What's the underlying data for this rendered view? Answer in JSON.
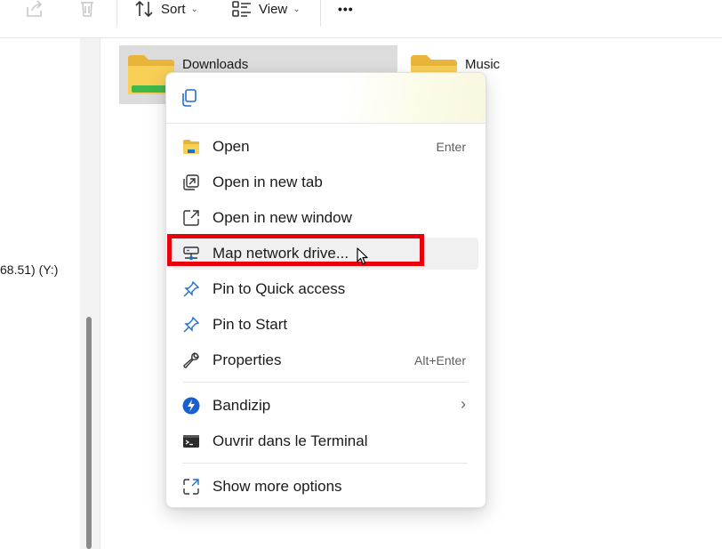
{
  "toolbar": {
    "sort_label": "Sort",
    "view_label": "View",
    "more_label": "•••"
  },
  "nav": {
    "drive_partial": "68.51) (Y:)"
  },
  "folders": [
    {
      "label": "Downloads"
    },
    {
      "label": "Music"
    }
  ],
  "menu": {
    "items": [
      {
        "label": "Open",
        "shortcut": "Enter",
        "icon": "folder-icon"
      },
      {
        "label": "Open in new tab",
        "icon": "new-tab-icon"
      },
      {
        "label": "Open in new window",
        "icon": "new-window-icon"
      },
      {
        "label": "Map network drive...",
        "icon": "network-drive-icon"
      },
      {
        "label": "Pin to Quick access",
        "icon": "pin-icon"
      },
      {
        "label": "Pin to Start",
        "icon": "pin-icon"
      },
      {
        "label": "Properties",
        "shortcut": "Alt+Enter",
        "icon": "wrench-icon"
      },
      {
        "label": "Bandizip",
        "submenu_arrow": "›",
        "icon": "bandizip-icon"
      },
      {
        "label": "Ouvrir dans le Terminal",
        "icon": "terminal-icon"
      },
      {
        "label": "Show more options",
        "icon": "show-more-icon"
      }
    ]
  },
  "colors": {
    "highlight": "#e8000b",
    "accent_blue": "#1f6fd1",
    "folder_yellow": "#f4c542"
  }
}
